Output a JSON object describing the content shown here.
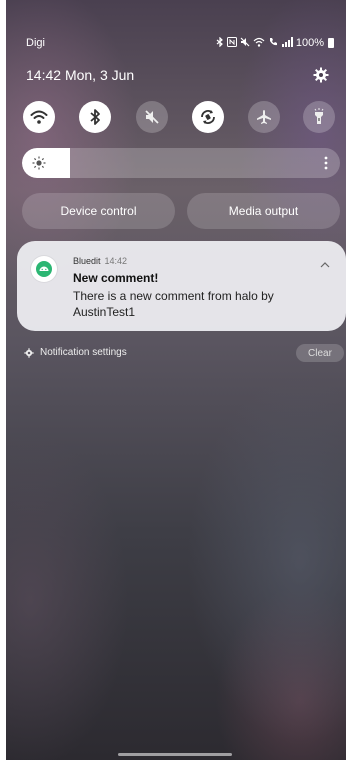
{
  "status_bar": {
    "carrier": "Digi",
    "battery": "100%",
    "icons": [
      "bluetooth-icon",
      "nfc-icon",
      "mute-icon",
      "wifi-icon",
      "call-icon",
      "signal-icon",
      "battery-icon"
    ]
  },
  "header": {
    "time": "14:42",
    "date": "Mon, 3 Jun"
  },
  "quick_toggles": [
    {
      "name": "wifi",
      "icon": "wifi-icon",
      "state": "on"
    },
    {
      "name": "bluetooth",
      "icon": "bluetooth-icon",
      "state": "on"
    },
    {
      "name": "sound",
      "icon": "mute-icon",
      "state": "off"
    },
    {
      "name": "auto-rotate",
      "icon": "rotate-icon",
      "state": "on"
    },
    {
      "name": "airplane-mode",
      "icon": "airplane-icon",
      "state": "off"
    },
    {
      "name": "flashlight",
      "icon": "flashlight-icon",
      "state": "off"
    }
  ],
  "brightness": {
    "level": 0.15
  },
  "buttons": {
    "device_control": "Device control",
    "media_output": "Media output"
  },
  "notification": {
    "app_name": "Bluedit",
    "time": "14:42",
    "title": "New comment!",
    "body": "There is a new comment from halo by AustinTest1",
    "accent": "#2bb673"
  },
  "footer": {
    "settings_label": "Notification settings",
    "clear_label": "Clear"
  }
}
